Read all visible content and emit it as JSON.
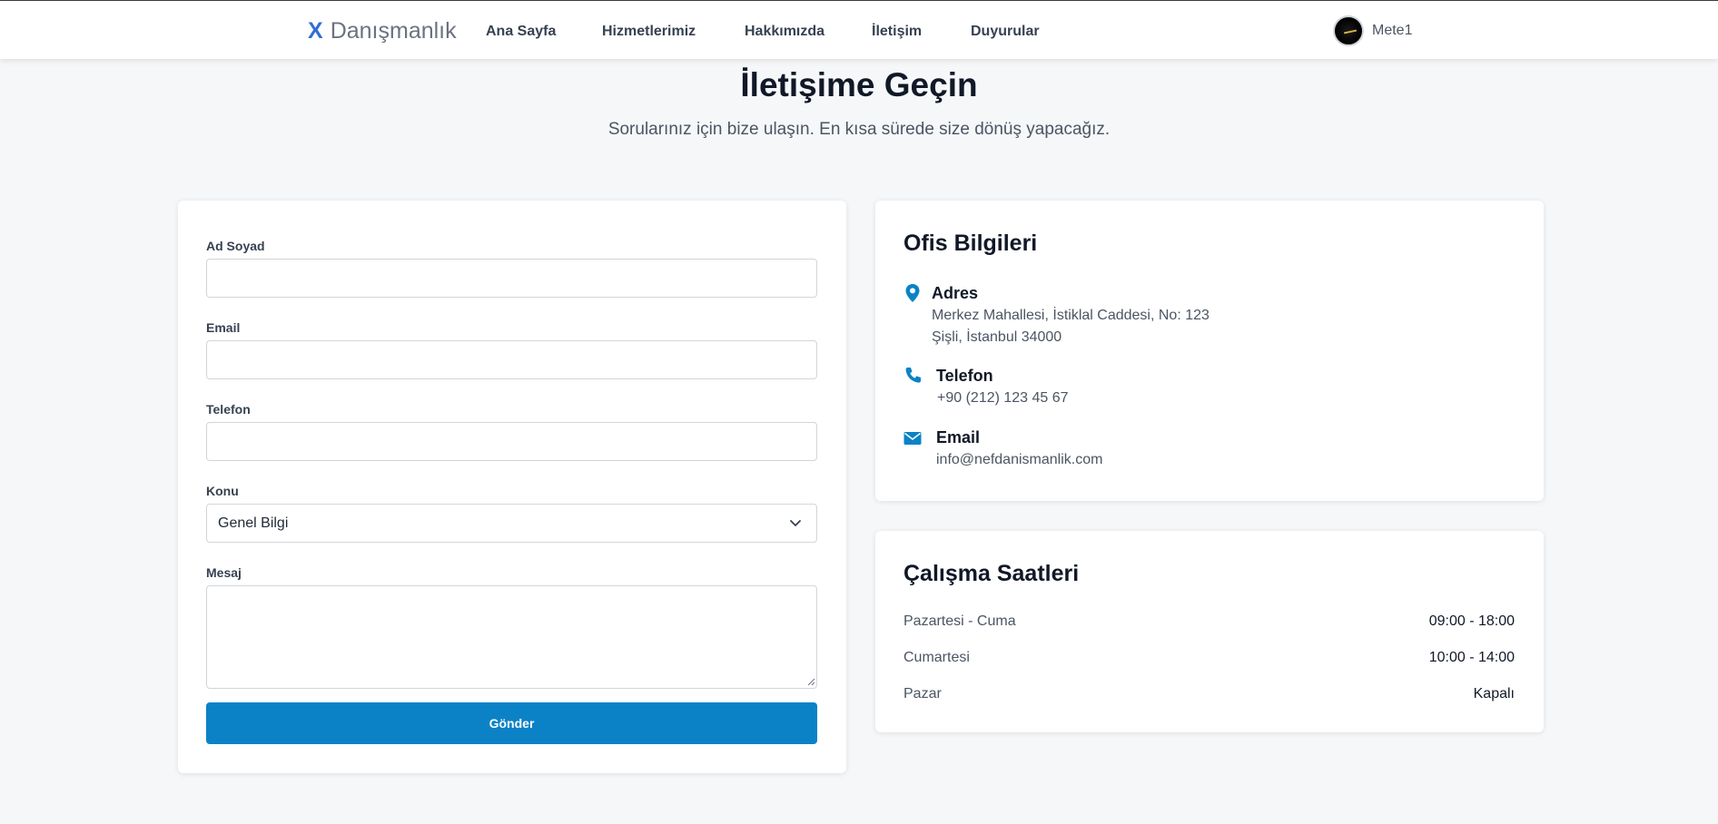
{
  "nav": {
    "brand_mark": "X",
    "brand_name": "Danışmanlık",
    "links": [
      "Ana Sayfa",
      "Hizmetlerimiz",
      "Hakkımızda",
      "İletişim",
      "Duyurular"
    ],
    "user_name": "Mete1"
  },
  "header": {
    "title": "İletişime Geçin",
    "subtitle": "Sorularınız için bize ulaşın. En kısa sürede size dönüş yapacağız."
  },
  "form": {
    "name_label": "Ad Soyad",
    "email_label": "Email",
    "phone_label": "Telefon",
    "subject_label": "Konu",
    "subject_value": "Genel Bilgi",
    "message_label": "Mesaj",
    "submit_label": "Gönder"
  },
  "office": {
    "title": "Ofis Bilgileri",
    "address_title": "Adres",
    "address_line1": "Merkez Mahallesi, İstiklal Caddesi, No: 123",
    "address_line2": "Şişli, İstanbul 34000",
    "phone_title": "Telefon",
    "phone_value": "+90 (212) 123 45 67",
    "email_title": "Email",
    "email_value": "info@nefdanismanlik.com"
  },
  "hours": {
    "title": "Çalışma Saatleri",
    "rows": [
      {
        "day": "Pazartesi - Cuma",
        "time": "09:00 - 18:00"
      },
      {
        "day": "Cumartesi",
        "time": "10:00 - 14:00"
      },
      {
        "day": "Pazar",
        "time": "Kapalı"
      }
    ]
  },
  "colors": {
    "accent": "#0b82c6",
    "brand": "#2f6fd6",
    "background": "#f5f7f9"
  }
}
